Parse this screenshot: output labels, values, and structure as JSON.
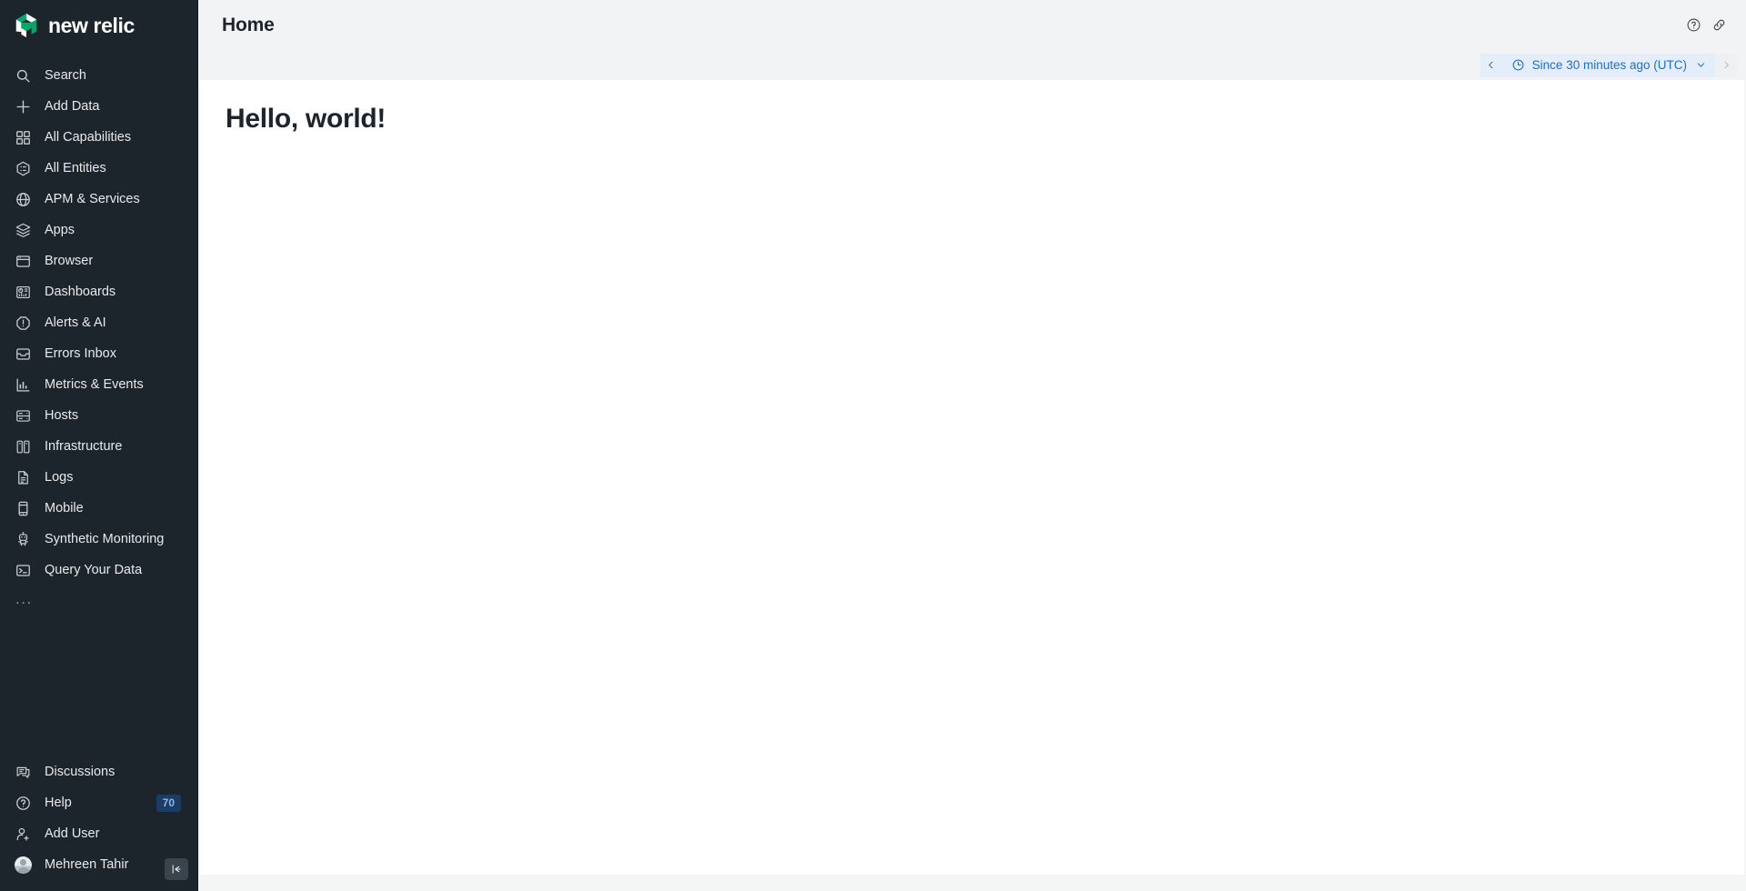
{
  "sidebar": {
    "brand": {
      "word": "new relic",
      "dot": ".",
      "logo_icon": "new-relic-cube-logo"
    },
    "items": [
      {
        "label": "Search",
        "icon": "search-icon"
      },
      {
        "label": "Add Data",
        "icon": "plus-icon"
      },
      {
        "label": "All Capabilities",
        "icon": "grid-squares-icon"
      },
      {
        "label": "All Entities",
        "icon": "hexagon-list-icon"
      },
      {
        "label": "APM & Services",
        "icon": "globe-icon"
      },
      {
        "label": "Apps",
        "icon": "layers-icon"
      },
      {
        "label": "Browser",
        "icon": "browser-window-icon"
      },
      {
        "label": "Dashboards",
        "icon": "dashboard-icon"
      },
      {
        "label": "Alerts & AI",
        "icon": "alert-exclamation-icon"
      },
      {
        "label": "Errors Inbox",
        "icon": "inbox-icon"
      },
      {
        "label": "Metrics & Events",
        "icon": "bar-chart-icon"
      },
      {
        "label": "Hosts",
        "icon": "server-rows-icon"
      },
      {
        "label": "Infrastructure",
        "icon": "infrastructure-columns-icon"
      },
      {
        "label": "Logs",
        "icon": "document-lines-icon"
      },
      {
        "label": "Mobile",
        "icon": "mobile-phone-icon"
      },
      {
        "label": "Synthetic Monitoring",
        "icon": "robot-icon"
      },
      {
        "label": "Query Your Data",
        "icon": "terminal-prompt-icon"
      }
    ],
    "more_label": "...",
    "footer": [
      {
        "label": "Discussions",
        "icon": "speech-bubble-icon",
        "badge": ""
      },
      {
        "label": "Help",
        "icon": "question-circle-icon",
        "badge": "70"
      },
      {
        "label": "Add User",
        "icon": "user-plus-icon",
        "badge": ""
      },
      {
        "label": "Mehreen Tahir",
        "icon": "avatar",
        "badge": ""
      }
    ],
    "collapse_icon": "collapse-left-icon"
  },
  "topbar": {
    "title": "Home",
    "help_icon": "question-circle-icon",
    "link_icon": "chain-link-icon"
  },
  "timepicker": {
    "prev_icon": "chevron-left-icon",
    "next_icon": "chevron-right-icon",
    "clock_icon": "clock-icon",
    "value": "Since 30 minutes ago (UTC)",
    "chevron_icon": "chevron-down-icon"
  },
  "content": {
    "heading": "Hello, world!"
  },
  "colors": {
    "sidebar_bg": "#1d252c",
    "accent_blue": "#1b6fd4",
    "timepicker_bg": "#e4edfa",
    "badge_bg": "#1c3c63",
    "badge_text": "#86b8f0",
    "logo_green": "#00ac69",
    "page_bg": "#f2f3f4",
    "card_bg": "#ffffff",
    "text_dark": "#1d252c"
  }
}
